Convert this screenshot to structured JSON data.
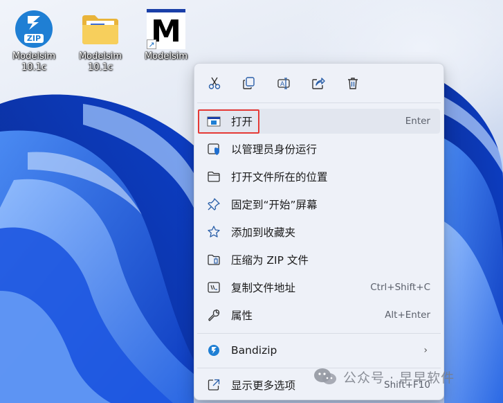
{
  "desktop": {
    "icons": [
      {
        "label_line1": "Modelsim",
        "label_line2": "10.1c",
        "icon": "bandizip-zip-archive-icon",
        "badge": "ZIP"
      },
      {
        "label_line1": "Modelsim",
        "label_line2": "10.1c",
        "icon": "folder-icon"
      },
      {
        "label_line1": "Modelsim",
        "label_line2": "",
        "icon": "modelsim-shortcut-icon",
        "badge": "M"
      }
    ]
  },
  "context_menu": {
    "toolbar": [
      {
        "name": "cut",
        "icon": "scissors-icon"
      },
      {
        "name": "copy",
        "icon": "copy-icon"
      },
      {
        "name": "rename",
        "icon": "rename-icon"
      },
      {
        "name": "share",
        "icon": "share-icon"
      },
      {
        "name": "delete",
        "icon": "trash-icon"
      }
    ],
    "items": [
      {
        "label": "打开",
        "shortcut": "Enter",
        "icon": "modelsim-app-icon",
        "highlighted": true
      },
      {
        "label": "以管理员身份运行",
        "shortcut": "",
        "icon": "shield-window-icon"
      },
      {
        "label": "打开文件所在的位置",
        "shortcut": "",
        "icon": "folder-outline-icon"
      },
      {
        "label": "固定到“开始”屏幕",
        "shortcut": "",
        "icon": "pin-icon"
      },
      {
        "label": "添加到收藏夹",
        "shortcut": "",
        "icon": "star-icon"
      },
      {
        "label": "压缩为 ZIP 文件",
        "shortcut": "",
        "icon": "zip-folder-icon"
      },
      {
        "label": "复制文件地址",
        "shortcut": "Ctrl+Shift+C",
        "icon": "copy-path-icon"
      },
      {
        "label": "属性",
        "shortcut": "Alt+Enter",
        "icon": "wrench-icon"
      }
    ],
    "bandizip": {
      "label": "Bandizip",
      "icon": "bandizip-icon",
      "submenu": "›"
    },
    "more": {
      "label": "显示更多选项",
      "shortcut": "Shift+F10",
      "icon": "external-window-icon"
    }
  },
  "watermark": {
    "text": "公众号 · 早早软件"
  },
  "colors": {
    "accent": "#1f7fd4",
    "highlight_border": "#e53935",
    "menu_bg": "#eef1f8"
  }
}
